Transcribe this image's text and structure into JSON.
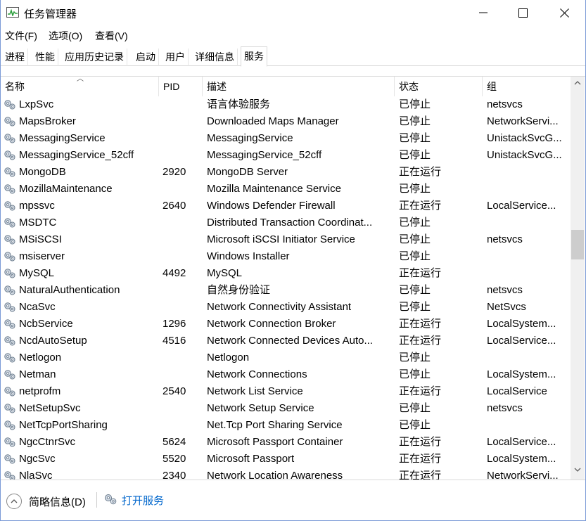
{
  "window": {
    "title": "任务管理器"
  },
  "menu": [
    "文件(F)",
    "选项(O)",
    "查看(V)"
  ],
  "tabs": [
    {
      "label": "进程",
      "active": false
    },
    {
      "label": "性能",
      "active": false
    },
    {
      "label": "应用历史记录",
      "active": false
    },
    {
      "label": "启动",
      "active": false
    },
    {
      "label": "用户",
      "active": false
    },
    {
      "label": "详细信息",
      "active": false
    },
    {
      "label": "服务",
      "active": true
    }
  ],
  "columns": {
    "name": "名称",
    "pid": "PID",
    "desc": "描述",
    "status": "状态",
    "group": "组"
  },
  "rows": [
    {
      "name": "LxpSvc",
      "pid": "",
      "desc": "语言体验服务",
      "status": "已停止",
      "group": "netsvcs"
    },
    {
      "name": "MapsBroker",
      "pid": "",
      "desc": "Downloaded Maps Manager",
      "status": "已停止",
      "group": "NetworkServi..."
    },
    {
      "name": "MessagingService",
      "pid": "",
      "desc": "MessagingService",
      "status": "已停止",
      "group": "UnistackSvcG..."
    },
    {
      "name": "MessagingService_52cff",
      "pid": "",
      "desc": "MessagingService_52cff",
      "status": "已停止",
      "group": "UnistackSvcG..."
    },
    {
      "name": "MongoDB",
      "pid": "2920",
      "desc": "MongoDB Server",
      "status": "正在运行",
      "group": ""
    },
    {
      "name": "MozillaMaintenance",
      "pid": "",
      "desc": "Mozilla Maintenance Service",
      "status": "已停止",
      "group": ""
    },
    {
      "name": "mpssvc",
      "pid": "2640",
      "desc": "Windows Defender Firewall",
      "status": "正在运行",
      "group": "LocalService..."
    },
    {
      "name": "MSDTC",
      "pid": "",
      "desc": "Distributed Transaction Coordinat...",
      "status": "已停止",
      "group": ""
    },
    {
      "name": "MSiSCSI",
      "pid": "",
      "desc": "Microsoft iSCSI Initiator Service",
      "status": "已停止",
      "group": "netsvcs"
    },
    {
      "name": "msiserver",
      "pid": "",
      "desc": "Windows Installer",
      "status": "已停止",
      "group": ""
    },
    {
      "name": "MySQL",
      "pid": "4492",
      "desc": "MySQL",
      "status": "正在运行",
      "group": ""
    },
    {
      "name": "NaturalAuthentication",
      "pid": "",
      "desc": "自然身份验证",
      "status": "已停止",
      "group": "netsvcs"
    },
    {
      "name": "NcaSvc",
      "pid": "",
      "desc": "Network Connectivity Assistant",
      "status": "已停止",
      "group": "NetSvcs"
    },
    {
      "name": "NcbService",
      "pid": "1296",
      "desc": "Network Connection Broker",
      "status": "正在运行",
      "group": "LocalSystem..."
    },
    {
      "name": "NcdAutoSetup",
      "pid": "4516",
      "desc": "Network Connected Devices Auto...",
      "status": "正在运行",
      "group": "LocalService..."
    },
    {
      "name": "Netlogon",
      "pid": "",
      "desc": "Netlogon",
      "status": "已停止",
      "group": ""
    },
    {
      "name": "Netman",
      "pid": "",
      "desc": "Network Connections",
      "status": "已停止",
      "group": "LocalSystem..."
    },
    {
      "name": "netprofm",
      "pid": "2540",
      "desc": "Network List Service",
      "status": "正在运行",
      "group": "LocalService"
    },
    {
      "name": "NetSetupSvc",
      "pid": "",
      "desc": "Network Setup Service",
      "status": "已停止",
      "group": "netsvcs"
    },
    {
      "name": "NetTcpPortSharing",
      "pid": "",
      "desc": "Net.Tcp Port Sharing Service",
      "status": "已停止",
      "group": ""
    },
    {
      "name": "NgcCtnrSvc",
      "pid": "5624",
      "desc": "Microsoft Passport Container",
      "status": "正在运行",
      "group": "LocalService..."
    },
    {
      "name": "NgcSvc",
      "pid": "5520",
      "desc": "Microsoft Passport",
      "status": "正在运行",
      "group": "LocalSystem..."
    },
    {
      "name": "NlaSvc",
      "pid": "2340",
      "desc": "Network Location Awareness",
      "status": "正在运行",
      "group": "NetworkServi..."
    }
  ],
  "footer": {
    "less_details": "简略信息(D)",
    "open_services": "打开服务"
  },
  "colors": {
    "link": "#0066cc",
    "border": "#d9d9d9",
    "scroll_thumb": "#cdcdcd"
  }
}
